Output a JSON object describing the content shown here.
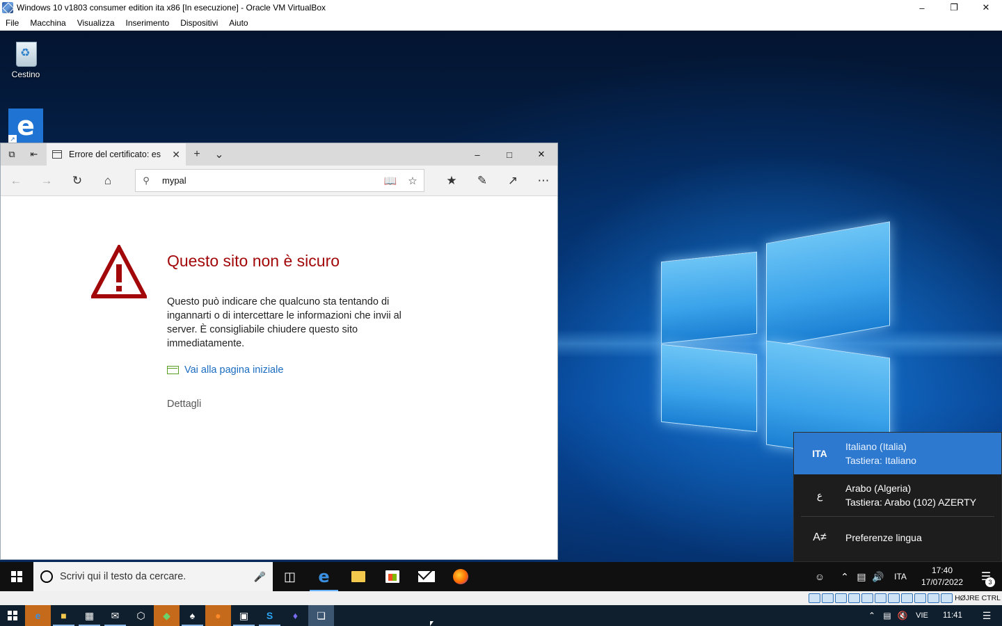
{
  "vbox": {
    "title": "Windows 10 v1803 consumer edition ita x86 [In esecuzione] - Oracle VM VirtualBox",
    "menu": [
      "File",
      "Macchina",
      "Visualizza",
      "Inserimento",
      "Dispositivi",
      "Aiuto"
    ],
    "host_key": "HØJRE CTRL"
  },
  "desktop": {
    "icons": [
      {
        "label": "Cestino"
      }
    ]
  },
  "edge": {
    "tab_title": "Errore del certificato: es",
    "address": "mypal",
    "error_title": "Questo sito non è sicuro",
    "error_body": "Questo può indicare che qualcuno sta tentando di ingannarti o di intercettare le informazioni che invii al server. È consigliabile chiudere questo sito immediatamente.",
    "home_link": "Vai alla pagina iniziale",
    "details": "Dettagli",
    "colors": {
      "error_red": "#a2070a",
      "link_blue": "#1a6cc0",
      "home_green": "#5a9e1f"
    }
  },
  "lang_flyout": {
    "items": [
      {
        "code": "ITA",
        "language": "Italiano (Italia)",
        "keyboard": "Tastiera: Italiano"
      },
      {
        "code": "ع",
        "language": "Arabo (Algeria)",
        "keyboard": "Tastiera: Arabo (102) AZERTY"
      }
    ],
    "preferences": "Preferenze lingua",
    "active_color": "#2e79d0"
  },
  "guest_taskbar": {
    "search_placeholder": "Scrivi qui il testo da cercare.",
    "lang": "ITA",
    "time": "17:40",
    "date": "17/07/2022",
    "notifications": "3"
  },
  "host_taskbar": {
    "lang": "VIE",
    "time": "11:41"
  }
}
